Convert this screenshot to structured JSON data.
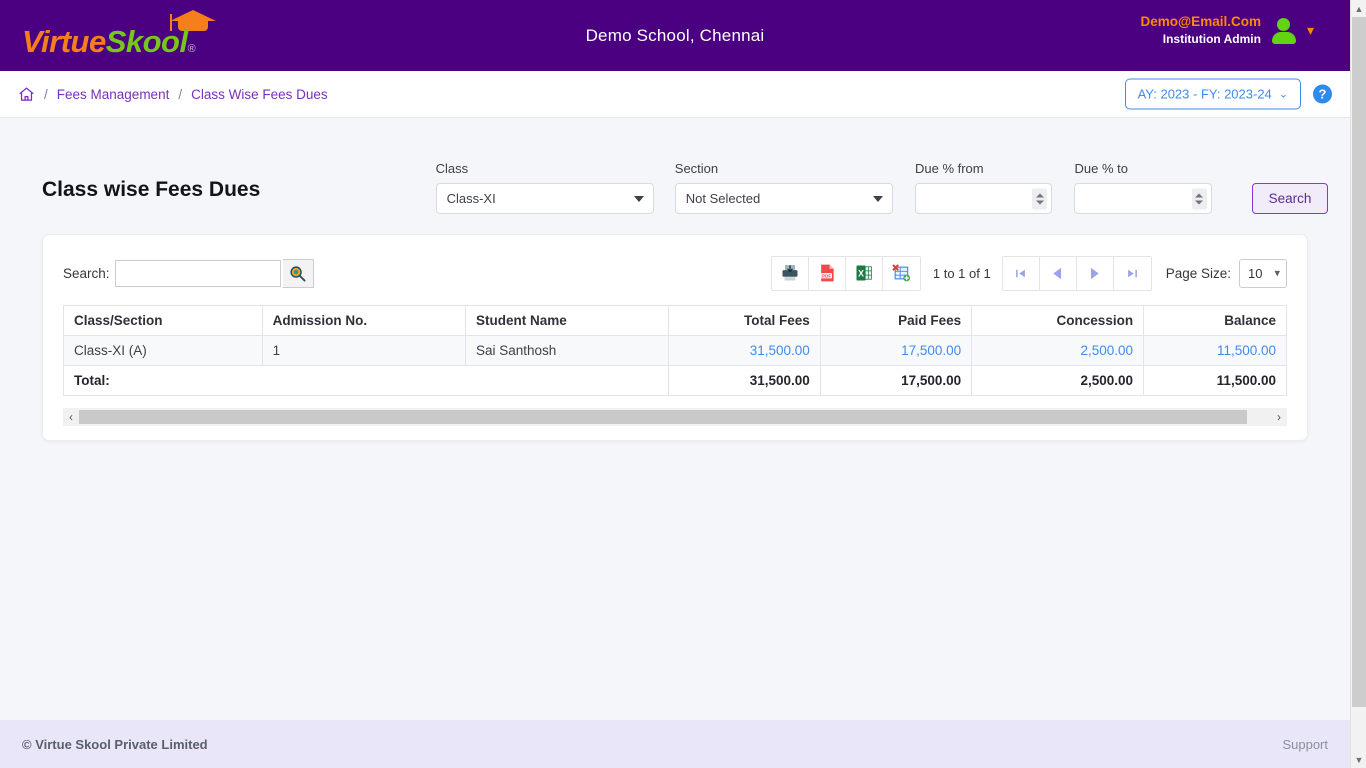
{
  "header": {
    "logo": {
      "part1": "Virtue",
      "part2": "Skool",
      "registered": "®",
      "cap_icon": "graduation-cap-icon"
    },
    "school_title": "Demo School, Chennai",
    "user_email": "Demo@Email.Com",
    "user_role": "Institution Admin",
    "avatar_icon": "user-avatar-icon",
    "caret_icon": "chevron-down-icon"
  },
  "breadcrumb": {
    "home_icon": "home-icon",
    "separator": "/",
    "items": [
      {
        "label": "Fees Management",
        "current": false
      },
      {
        "label": "Class Wise Fees Dues",
        "current": true
      }
    ],
    "academic_year": "AY: 2023 - FY: 2023-24",
    "academic_year_chevron": "⌄",
    "help_label": "?"
  },
  "filters": {
    "page_title": "Class wise Fees Dues",
    "class": {
      "label": "Class",
      "value": "Class-XI"
    },
    "section": {
      "label": "Section",
      "value": "Not Selected"
    },
    "due_from": {
      "label": "Due % from",
      "value": "",
      "placeholder": ""
    },
    "due_to": {
      "label": "Due % to",
      "value": "",
      "placeholder": ""
    },
    "search_button": "Search"
  },
  "grid_toolbar": {
    "search_label": "Search:",
    "search_value": "",
    "search_placeholder": "",
    "search_icon": "magnifier-icon",
    "exports": [
      {
        "name": "print-export-button",
        "title": "Print"
      },
      {
        "name": "pdf-export-button",
        "title": "PDF"
      },
      {
        "name": "excel-export-button",
        "title": "Excel"
      },
      {
        "name": "csv-export-button",
        "title": "CSV"
      }
    ],
    "page_count": "1 to 1 of 1",
    "pager": [
      {
        "name": "first-page-button",
        "icon": "first-page-icon"
      },
      {
        "name": "previous-page-button",
        "icon": "previous-page-icon"
      },
      {
        "name": "next-page-button",
        "icon": "next-page-icon"
      },
      {
        "name": "last-page-button",
        "icon": "last-page-icon"
      }
    ],
    "page_size_label": "Page Size:",
    "page_size_value": "10"
  },
  "table": {
    "columns": [
      {
        "label": "Class/Section",
        "align": "left"
      },
      {
        "label": "Admission No.",
        "align": "left"
      },
      {
        "label": "Student Name",
        "align": "left"
      },
      {
        "label": "Total Fees",
        "align": "right"
      },
      {
        "label": "Paid Fees",
        "align": "right"
      },
      {
        "label": "Concession",
        "align": "right"
      },
      {
        "label": "Balance",
        "align": "right"
      }
    ],
    "rows": [
      {
        "class_section": "Class-XI (A)",
        "admission_no": "1",
        "student_name": "Sai Santhosh",
        "total_fees": "31,500.00",
        "paid_fees": "17,500.00",
        "concession": "2,500.00",
        "balance": "11,500.00"
      }
    ],
    "total_row": {
      "label": "Total:",
      "total_fees": "31,500.00",
      "paid_fees": "17,500.00",
      "concession": "2,500.00",
      "balance": "11,500.00"
    }
  },
  "footer": {
    "copyright": "© Virtue Skool Private Limited",
    "support": "Support"
  },
  "colors": {
    "brand_purple": "#4b0082",
    "logo_orange": "#f77f1b",
    "logo_green": "#78c51c",
    "link_blue": "#3f8bf0",
    "crumb_purple": "#7b2fbe",
    "footer_bg": "#eae6fa",
    "page_bg": "#f4f6fa"
  }
}
